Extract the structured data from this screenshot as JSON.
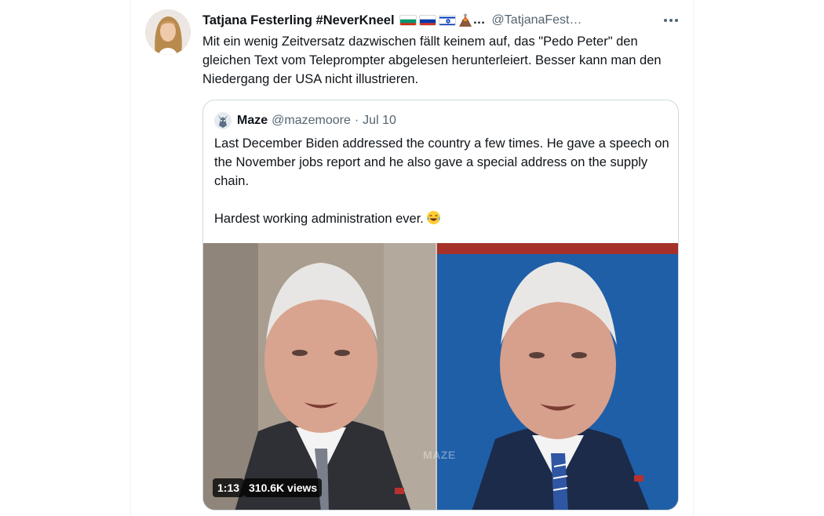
{
  "tweet": {
    "display_name": "Tatjana Festerling #NeverKneel",
    "name_suffix": "…",
    "handle": "@TatjanaFest…",
    "flags": [
      "bulgaria-flag",
      "russia-flag",
      "israel-flag",
      "volcano-emoji"
    ],
    "text": "Mit ein wenig Zeitversatz dazwischen fällt keinem auf, das \"Pedo Peter\" den gleichen Text vom Teleprompter abgelesen herunterleiert. Besser kann man den Niedergang der USA nicht illustrieren.",
    "more_icon": "more-horizontal-icon"
  },
  "quote": {
    "name": "Maze",
    "handle": "@mazemoore",
    "separator": "·",
    "date": "Jul 10",
    "line1": "Last December Biden addressed the country a few times. He gave a speech on the November jobs report and he also gave a special address on the supply chain.",
    "line2": "Hardest working administration ever.",
    "line2_icon": "face-with-tears-of-joy-emoji"
  },
  "media": {
    "watermark": "MAZE",
    "duration": "1:13",
    "views": "310.6K views"
  },
  "colors": {
    "text_primary": "#0f1419",
    "text_secondary": "#536471",
    "border": "#cfd9de",
    "right_frame_bg": "#1f5fa8"
  }
}
